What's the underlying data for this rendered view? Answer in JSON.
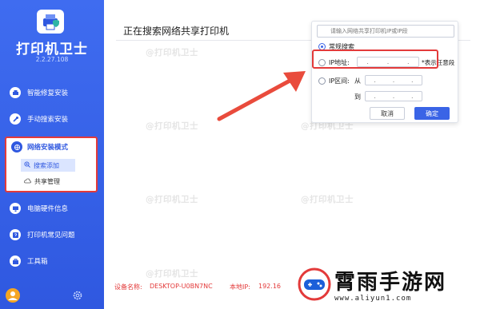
{
  "app": {
    "title": "打印机卫士",
    "version": "2.2.27.108"
  },
  "sidebar": {
    "items": [
      {
        "label": "智能修复安装",
        "icon": "printer-icon"
      },
      {
        "label": "手动搜索安装",
        "icon": "wrench-icon"
      },
      {
        "label": "电脑硬件信息",
        "icon": "computer-icon"
      },
      {
        "label": "打印机常见问题",
        "icon": "help-icon"
      },
      {
        "label": "工具箱",
        "icon": "toolbox-icon"
      }
    ],
    "group": {
      "label": "网络安装模式",
      "icon": "network-icon",
      "sub_items": [
        {
          "label": "搜索添加",
          "active": true
        },
        {
          "label": "共享管理",
          "active": false
        }
      ]
    }
  },
  "main": {
    "title": "正在搜索网络共享打印机",
    "watermark": "@打印机卫士"
  },
  "search_popup": {
    "placeholder": "请输入网络共享打印机IP或IP段",
    "option_normal": "常规搜索",
    "option_ip": "IP地址:",
    "option_range": "IP区间:",
    "wildcard_hint": "*表示任意段",
    "from_label": "从",
    "to_label": "到",
    "cancel": "取消",
    "confirm": "确定"
  },
  "footer": {
    "device_label": "设备名称:",
    "device_value": "DESKTOP-U0BN7NC",
    "ip_label": "本地IP:",
    "ip_value": "192.16"
  },
  "brand": {
    "name": "霄雨手游网",
    "url": "www.aliyun1.com"
  },
  "colors": {
    "sidebar": "#2f58e0",
    "accent": "#3a64e6",
    "highlight": "#e33a3a"
  }
}
